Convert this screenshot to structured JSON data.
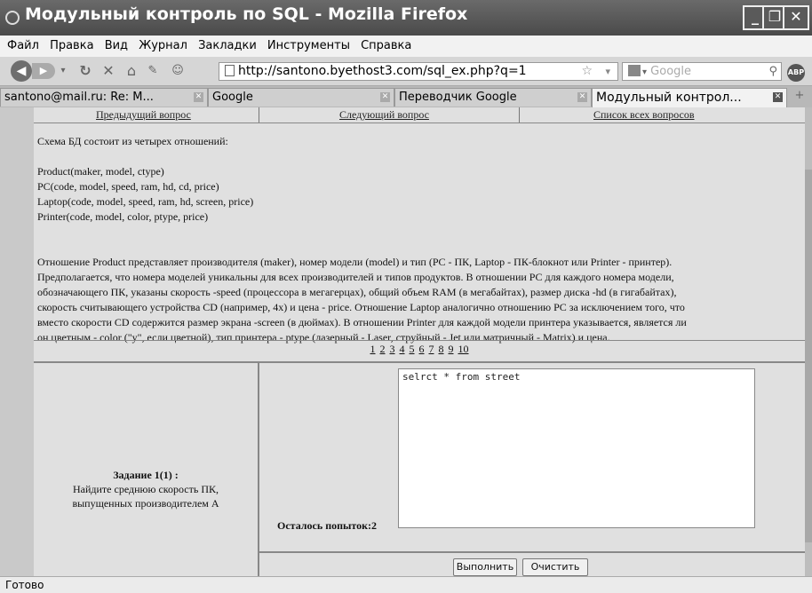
{
  "window": {
    "title": "Модульный контроль по SQL - Mozilla Firefox",
    "minimize": "_",
    "maximize": "❐",
    "close": "✕"
  },
  "menu": [
    "Файл",
    "Правка",
    "Вид",
    "Журнал",
    "Закладки",
    "Инструменты",
    "Справка"
  ],
  "nav": {
    "back_icon": "arrow-left-icon",
    "forward_icon": "arrow-right-icon",
    "url": "http://santono.byethost3.com/sql_ex.php?q=1",
    "search_placeholder": "Google",
    "abp_label": "ABP"
  },
  "tabs": [
    {
      "label": "santono@mail.ru: Re: M...",
      "active": false
    },
    {
      "label": "Google",
      "active": false
    },
    {
      "label": "Переводчик Google",
      "active": false
    },
    {
      "label": "Модульный контрол...",
      "active": true
    }
  ],
  "page": {
    "nav_links": [
      "Предыдущий вопрос",
      "Следующий вопрос",
      "Список всех вопросов"
    ],
    "schema_intro": "Схема БД состоит из четырех отношений:",
    "relations": [
      "Product(maker, model, ctype)",
      "PC(code, model, speed, ram, hd, cd, price)",
      "Laptop(code, model, speed, ram, hd, screen, price)",
      "Printer(code, model, color, ptype, price)"
    ],
    "description_lines": [
      "Отношение Product представляет производителя (maker), номер модели (model) и тип (PC - ПК, Laptop - ПК-блокнот или Printer - принтер).",
      "Предполагается, что номера моделей уникальны для всех производителей и типов продуктов. В отношении PC для каждого номера модели,",
      "обозначающего ПК, указаны скорость -speed (процессора в мегагерцах), общий объем RAM (в мегабайтах), размер диска -hd (в гигабайтах),",
      "скорость считывающего устройства CD (например, 4x) и цена - price. Отношение Laptop аналогично отношению PC за исключением того, что",
      "вместо скорости CD содержится размер экрана -screen (в дюймах). В отношении Printer для каждой модели принтера указывается, является ли",
      "он цветным - color (\"y\", если цветной), тип принтера - ptype (лазерный - Laser, струйный - Jet или матричный - Matrix) и цена."
    ],
    "pages": [
      "1",
      "2",
      "3",
      "4",
      "5",
      "6",
      "7",
      "8",
      "9",
      "10"
    ],
    "task_title": "Задание 1(1) :",
    "task_line1": "Найдите среднюю скорость ПК,",
    "task_line2": "выпущенных производителем А",
    "attempts_label": "Осталось попыток:2",
    "sql_text": "selrct * from street",
    "run_button": "Выполнить",
    "clear_button": "Очистить"
  },
  "status": "Готово"
}
